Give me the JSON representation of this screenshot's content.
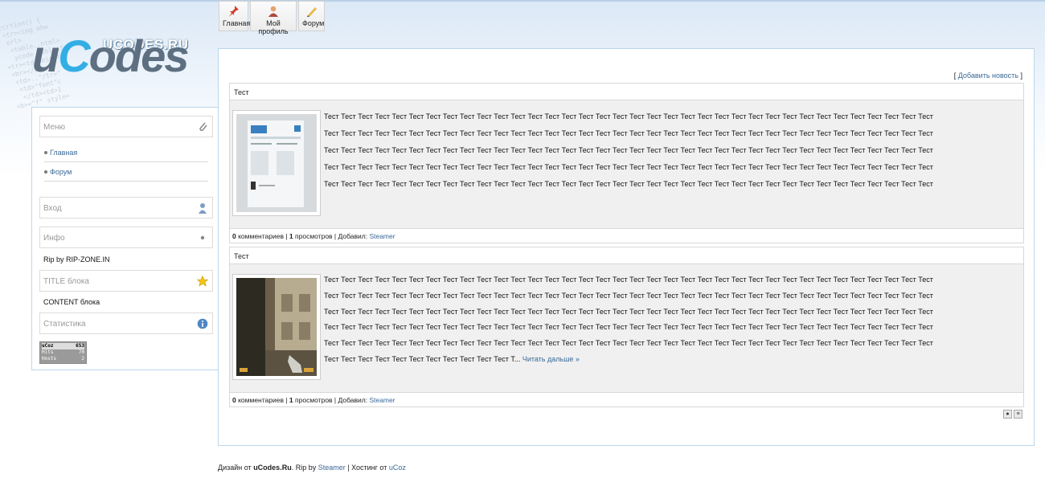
{
  "logo": {
    "small_text": "UCODES.RU",
    "big_u": "u",
    "big_c": "C",
    "big_rest": "odes",
    "code_lines": [
      "ccrtion() {",
      "<tr><img mhw",
      "erl>",
      "<table..html>",
      "ycode_tabl.if",
      "<tr><td height>",
      "<br></br>",
      "<td>..\"/tr>\"",
      "<td>\"font\"c",
      "</td><td>1",
      "<b>=\"f\" style="
    ]
  },
  "topnav": [
    {
      "label": "Главная",
      "icon": "pin-icon"
    },
    {
      "label": "Мой профиль",
      "icon": "user-icon"
    },
    {
      "label": "Форум",
      "icon": "pencil-icon"
    }
  ],
  "sidebar": {
    "menu_title": "Меню",
    "menu_items": [
      "Главная",
      "Форум"
    ],
    "login_title": "Вход",
    "info_title": "Инфо",
    "info_text": "Rip by RIP-ZONE.IN",
    "title_block": "TITLE блока",
    "content_block": "CONTENT блока",
    "stats_title": "Статистика",
    "counter": {
      "brand": "uCoz",
      "total": "653",
      "hits_label": "Hits",
      "hits": "70",
      "hosts_label": "Hosts",
      "hosts": "2"
    }
  },
  "main": {
    "add_news_open": "[ ",
    "add_news": "Добавить новость",
    "add_news_close": " ]",
    "posts": [
      {
        "title": "Тест",
        "lines": [
          "Тест Тест Тест Тест Тест Тест Тест Тест Тест Тест Тест Тест Тест Тест Тест Тест Тест Тест Тест Тест Тест Тест Тест Тест Тест Тест Тест Тест Тест Тест Тест Тест Тест Тест Тест Тест",
          "Тест Тест Тест Тест Тест Тест Тест Тест Тест Тест Тест Тест Тест Тест Тест Тест Тест Тест Тест Тест Тест Тест Тест Тест Тест Тест Тест Тест Тест Тест Тест Тест Тест Тест Тест Тест",
          "Тест Тест Тест Тест Тест Тест Тест Тест Тест Тест Тест Тест Тест Тест Тест Тест Тест Тест Тест Тест Тест Тест Тест Тест Тест Тест Тест Тест Тест Тест Тест Тест Тест Тест Тест Тест",
          "Тест Тест Тест Тест Тест Тест Тест Тест Тест Тест Тест Тест Тест Тест Тест Тест Тест Тест Тест Тест Тест Тест Тест Тест Тест Тест Тест Тест Тест Тест Тест Тест Тест Тест Тест Тест",
          "Тест Тест Тест Тест Тест Тест Тест Тест Тест Тест Тест Тест Тест Тест Тест Тест Тест Тест Тест Тест Тест Тест Тест Тест Тест Тест Тест Тест Тест Тест Тест Тест Тест Тест Тест Тест"
        ],
        "comments": "0",
        "comments_label": " комментариев | ",
        "views": "1",
        "views_label": " просмотров | Добавил: ",
        "author": "Steamer"
      },
      {
        "title": "Тест",
        "lines": [
          "Тест Тест Тест Тест Тест Тест Тест Тест Тест Тест Тест Тест Тест Тест Тест Тест Тест Тест Тест Тест Тест Тест Тест Тест Тест Тест Тест Тест Тест Тест Тест Тест Тест Тест Тест Тест",
          "Тест Тест Тест Тест Тест Тест Тест Тест Тест Тест Тест Тест Тест Тест Тест Тест Тест Тест Тест Тест Тест Тест Тест Тест Тест Тест Тест Тест Тест Тест Тест Тест Тест Тест Тест Тест",
          "Тест Тест Тест Тест Тест Тест Тест Тест Тест Тест Тест Тест Тест Тест Тест Тест Тест Тест Тест Тест Тест Тест Тест Тест Тест Тест Тест Тест Тест Тест Тест Тест Тест Тест Тест Тест",
          "Тест Тест Тест Тест Тест Тест Тест Тест Тест Тест Тест Тест Тест Тест Тест Тест Тест Тест Тест Тест Тест Тест Тест Тест Тест Тест Тест Тест Тест Тест Тест Тест Тест Тест Тест Тест",
          "Тест Тест Тест Тест Тест Тест Тест Тест Тест Тест Тест Тест Тест Тест Тест Тест Тест Тест Тест Тест Тест Тест Тест Тест Тест Тест Тест Тест Тест Тест Тест Тест Тест Тест Тест Тест"
        ],
        "last_line": "Тест Тест Тест Тест Тест Тест Тест Тест Тест Тест Тест Т... ",
        "read_more": "Читать дальше »",
        "comments": "0",
        "comments_label": " комментариев | ",
        "views": "1",
        "views_label": " просмотров | Добавил: ",
        "author": "Steamer"
      }
    ]
  },
  "footer": {
    "design_prefix": "Дизайн от ",
    "design_brand": "uCodes.Ru",
    "rip_text": ". Rip by ",
    "rip_author": "Steamer",
    "hosting_text": " | Хостинг от ",
    "hosting_link": "uCoz"
  }
}
